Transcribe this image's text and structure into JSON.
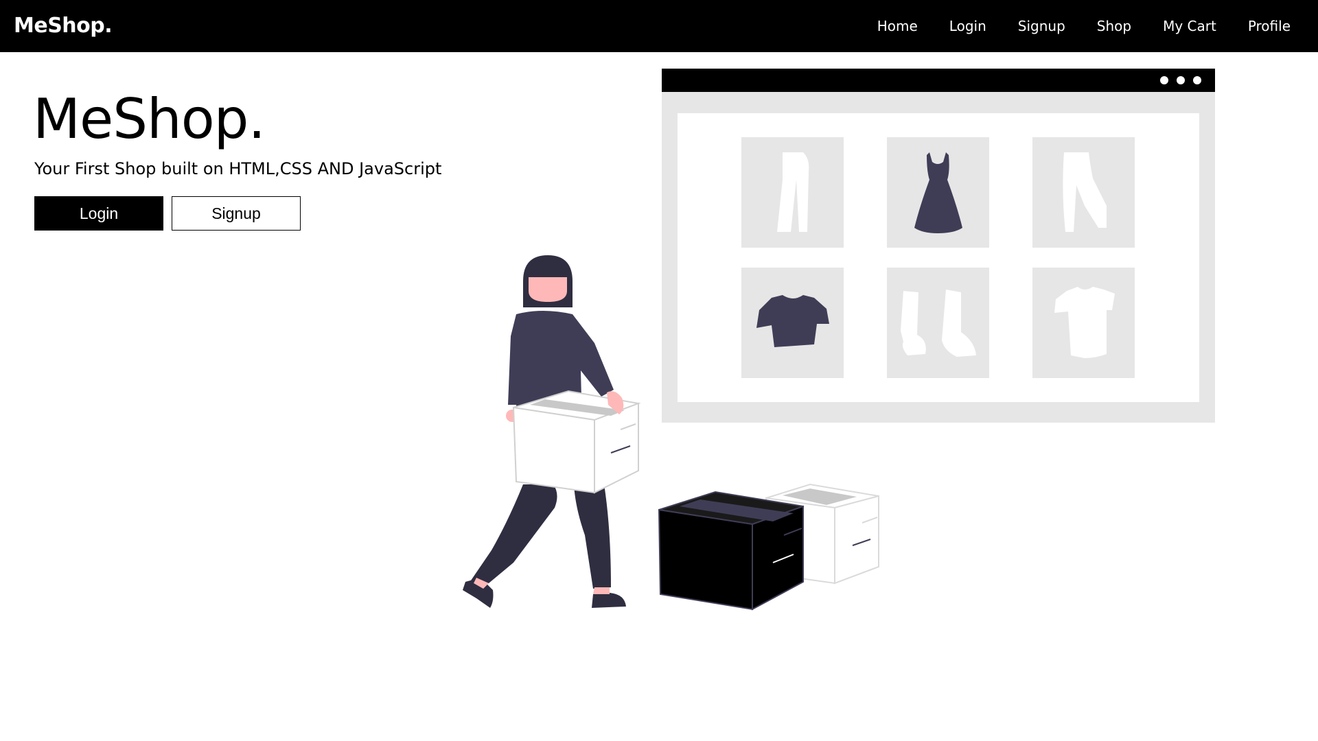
{
  "navbar": {
    "brand": "MeShop.",
    "links": [
      {
        "label": "Home"
      },
      {
        "label": "Login"
      },
      {
        "label": "Signup"
      },
      {
        "label": "Shop"
      },
      {
        "label": "My Cart"
      },
      {
        "label": "Profile"
      }
    ]
  },
  "hero": {
    "title": "MeShop.",
    "subtitle": "Your First Shop built on HTML,CSS AND JavaScript",
    "login_button": "Login",
    "signup_button": "Signup"
  },
  "colors": {
    "navbar_bg": "#000000",
    "accent": "#000000",
    "figure_dark": "#3f3d56",
    "skin": "#ffb8b8",
    "panel_gray": "#e6e6e6"
  },
  "illustration": {
    "name": "woman-carrying-box-online-shop",
    "product_icons": [
      "pants-icon",
      "dress-icon",
      "leggings-icon",
      "shirt-icon",
      "boots-icon",
      "tshirt-icon"
    ]
  }
}
